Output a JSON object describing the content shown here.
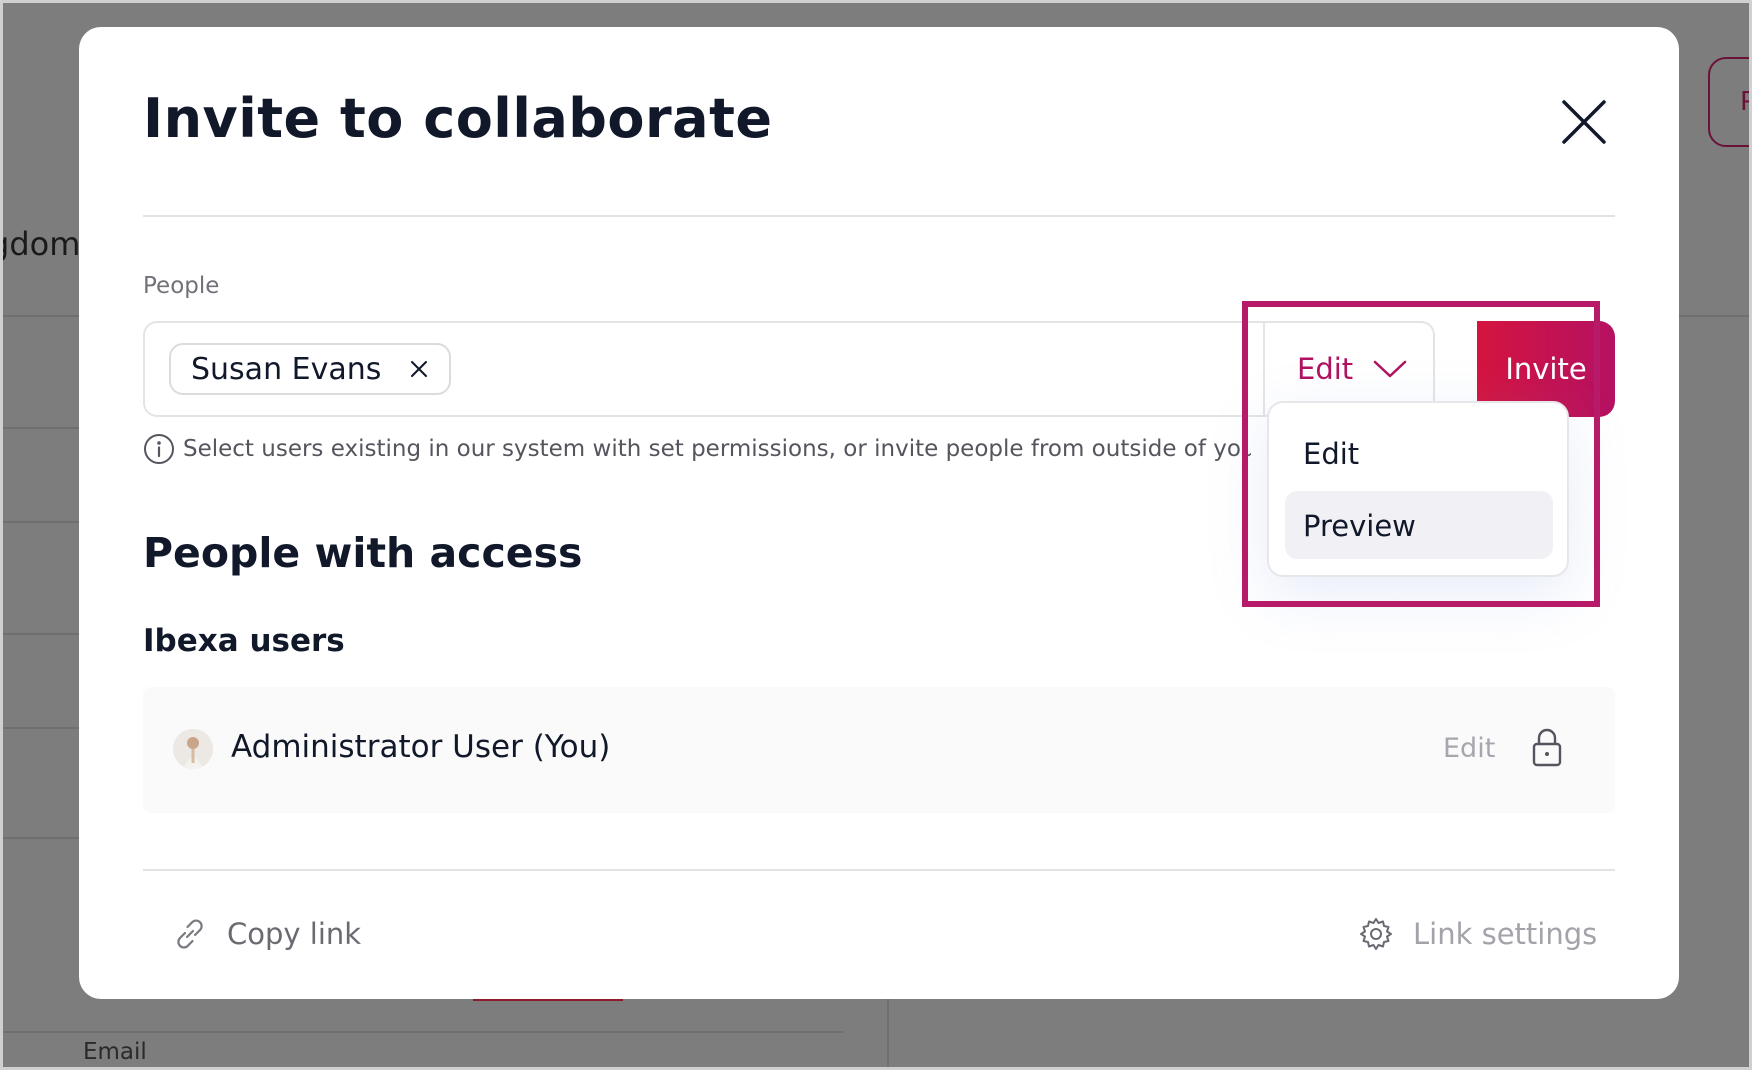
{
  "background": {
    "partial_text_left": "gdom",
    "partial_button_text": "P",
    "email_label": "Email"
  },
  "modal": {
    "title": "Invite to collaborate",
    "people_label": "People",
    "selected_chip": "Susan Evans",
    "permission_selected": "Edit",
    "invite_button": "Invite",
    "helper_text": "Select users existing in our system with set permissions, or invite people from outside of your organization",
    "dropdown_options": [
      {
        "label": "Edit",
        "hovered": false
      },
      {
        "label": "Preview",
        "hovered": true
      }
    ],
    "section_title": "People with access",
    "group_title": "Ibexa users",
    "users": [
      {
        "name": "Administrator User (You)",
        "permission": "Edit",
        "locked": true
      }
    ],
    "footer": {
      "copy_link": "Copy link",
      "link_settings": "Link settings"
    }
  },
  "colors": {
    "accent": "#b0125f",
    "invite_gradient_start": "#d4143f",
    "invite_gradient_end": "#b51162",
    "highlight": "#b81a6a"
  }
}
